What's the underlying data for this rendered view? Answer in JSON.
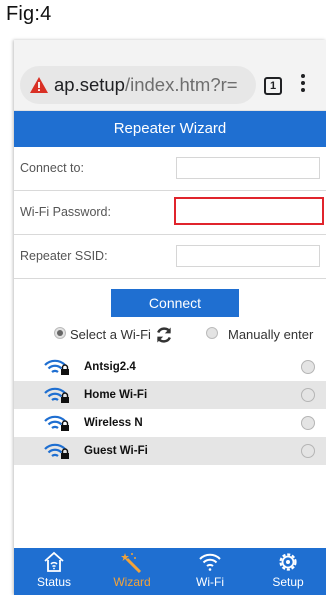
{
  "figure_label": "Fig:4",
  "browser": {
    "url_host": "ap.setup",
    "url_path": "/index.htm?r=",
    "tab_count": "1"
  },
  "header": {
    "title": "Repeater Wizard"
  },
  "form": {
    "connect_to_label": "Connect to:",
    "connect_to_value": "",
    "password_label": "Wi-Fi Password:",
    "password_value": "",
    "ssid_label": "Repeater SSID:",
    "ssid_value": "",
    "connect_button": "Connect"
  },
  "mode": {
    "select_label": "Select a Wi-Fi",
    "manual_label": "Manually enter",
    "selected": "select"
  },
  "networks": [
    {
      "name": "Antsig2.4"
    },
    {
      "name": "Home Wi-Fi"
    },
    {
      "name": "Wireless N"
    },
    {
      "name": "Guest Wi-Fi"
    }
  ],
  "nav": {
    "status": "Status",
    "wizard": "Wizard",
    "wifi": "Wi-Fi",
    "setup": "Setup",
    "active": "wizard"
  },
  "colors": {
    "brand_blue": "#1f6fd1",
    "active_nav": "#f2a33a",
    "highlight_red": "#e0242c",
    "warning_red": "#d93025"
  },
  "icons": [
    "warning-triangle-icon",
    "refresh-icon",
    "wifi-lock-icon",
    "home-icon",
    "wand-icon",
    "wifi-icon",
    "gear-icon"
  ]
}
